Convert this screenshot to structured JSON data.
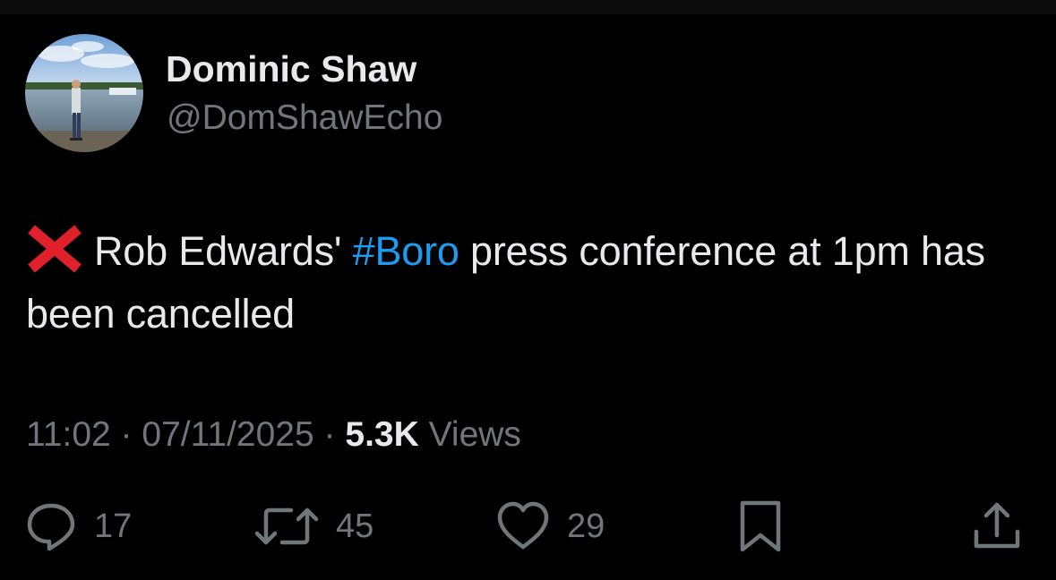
{
  "colors": {
    "background": "#000000",
    "primary_text": "#e7e9ea",
    "secondary_text": "#71767b",
    "hashtag": "#1d9bf0",
    "cross_mark": "#e0202b"
  },
  "author": {
    "display_name": "Dominic Shaw",
    "handle": "@DomShawEcho",
    "avatar_icon": "avatar-photo-lake"
  },
  "tweet": {
    "emoji": "cross-mark-icon",
    "text_before": "Rob Edwards' ",
    "hashtag": "#Boro",
    "text_after": " press conference at 1pm has been cancelled"
  },
  "meta": {
    "time": "11:02",
    "separator": "·",
    "date": "07/11/2025",
    "views_count": "5.3K",
    "views_label": "Views"
  },
  "actions": {
    "reply": {
      "icon": "reply-icon",
      "count": "17"
    },
    "retweet": {
      "icon": "retweet-icon",
      "count": "45"
    },
    "like": {
      "icon": "heart-icon",
      "count": "29"
    },
    "bookmark": {
      "icon": "bookmark-icon"
    },
    "share": {
      "icon": "share-icon"
    }
  }
}
